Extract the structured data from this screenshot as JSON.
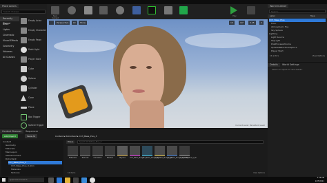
{
  "app": {
    "title": "PLACE_ACTORS"
  },
  "place_panel": {
    "tab": "Place Actors",
    "search_placeholder": "Search Classes",
    "categories": [
      "Recently Placed",
      "Basic",
      "Lights",
      "Cinematic",
      "Visual Effects",
      "Geometry",
      "Volumes",
      "All Classes"
    ],
    "items": [
      "Empty Actor",
      "Empty Character",
      "Empty Pawn",
      "Point Light",
      "Player Start",
      "Cube",
      "Sphere",
      "Cylinder",
      "Cone",
      "Plane",
      "Box Trigger",
      "Sphere Trigger"
    ]
  },
  "toolbar": {
    "buttons": [
      "Save Current",
      "Source Control",
      "Content",
      "Marketplace",
      "Settings",
      "Blueprints",
      "Cinematics",
      "Build",
      "Compile",
      "Play",
      "Launch"
    ]
  },
  "viewport": {
    "perspective_label": "Perspective",
    "lit_label": "Lit",
    "show_label": "Show",
    "snap_value": "10",
    "angle_value": "10°",
    "scale_value": "0.25",
    "grid_value": "4",
    "watermark": "Current Level: Persistent Level"
  },
  "world_outliner": {
    "tab": "World Outliner",
    "search_placeholder": "Search...",
    "header_label": "Label",
    "header_type": "Type",
    "rows": [
      "CC3_Base_Plus",
      "Floor",
      "Atmospheric Fog",
      "Sky Sphere",
      "Lighting",
      "Light Source",
      "SkyLight",
      "PostProcessVolume",
      "SphereReflectionCapture",
      "Player Start",
      "Actors_Light",
      "CC3_Camera",
      "DirectionalLight",
      "BP_Character"
    ],
    "actor_count": "14 actors",
    "view_options": "View Options"
  },
  "details": {
    "tabs": [
      "Details",
      "World Settings"
    ],
    "empty_message": "Select an object to view details."
  },
  "content_browser": {
    "tabs": [
      "Content Browser",
      "Sequencer"
    ],
    "add_new": "Add/Import",
    "save_all": "Save All",
    "path": [
      "Content",
      "RLContent",
      "CC3_Base_Plus_3"
    ],
    "filters": "Filters",
    "search_placeholder": "Search CC3_Base_Plus_3",
    "tree": [
      "Content",
      "Geometry",
      "Materials",
      "Mannequin",
      "StarterContent",
      "RLContent",
      "CC3_Base_Plus_3",
      "CC3_Base_Plus_3_Skin",
      "Materials",
      "Textures"
    ],
    "assets": [
      "Materials",
      "Textures",
      "Animation",
      "Meshes",
      "Physics",
      "CC3_Base_Plus_3",
      "CC3_Base_Plus_3_PA",
      "CC3_Base_Plus_3_Sk",
      "CC3_Base_Plus_3_AnimBP",
      "CC3_Base_Plus_3_Sh"
    ],
    "item_count": "10 items",
    "view_options": "View Options"
  },
  "taskbar": {
    "search_placeholder": "Type here to search",
    "time": "3:38 PM",
    "date": "2/25/2021"
  },
  "colors": {
    "accent": "#2f7ad8",
    "panel": "#252525",
    "bg": "#151515"
  }
}
